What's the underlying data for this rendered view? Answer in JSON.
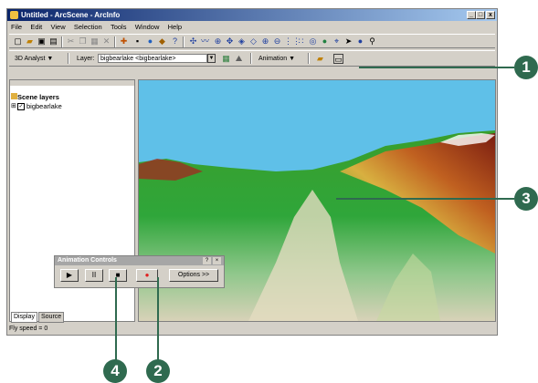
{
  "window": {
    "title": "Untitled - ArcScene - ArcInfo"
  },
  "menu": [
    "File",
    "Edit",
    "View",
    "Selection",
    "Tools",
    "Window",
    "Help"
  ],
  "toolbar2": {
    "analyst_label": "3D Analyst",
    "layer_label": "Layer:",
    "layer_value": "bigbearlake <bigbearlake>",
    "animation_label": "Animation"
  },
  "toc": {
    "title": "Scene layers",
    "layer": "bigbearlake",
    "tabs": [
      "Display",
      "Source"
    ]
  },
  "status": {
    "text": "Fly speed = 0"
  },
  "animation_controls": {
    "title": "Animation Controls",
    "help": "?",
    "close": "×",
    "play": "▶",
    "pause": "II",
    "stop": "■",
    "record": "●",
    "options": "Options >>"
  },
  "callouts": [
    "1",
    "2",
    "3",
    "4"
  ]
}
